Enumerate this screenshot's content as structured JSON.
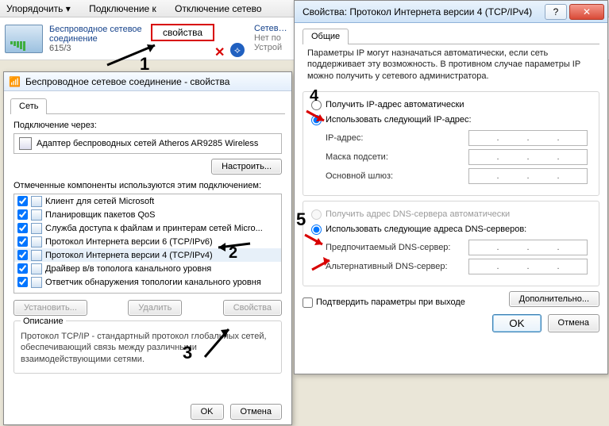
{
  "toolbar": {
    "item1": "Упорядочить ▾",
    "item2": "Подключение к",
    "item3": "Отключение сетево"
  },
  "network": {
    "name": "Беспроводное сетевое",
    "name2": "соединение",
    "detail": "615/3",
    "right_name": "Сетев…",
    "right_status": "Нет по",
    "right_line3": "Устрой"
  },
  "redbox_label": "свойства",
  "annot": {
    "n1": "1",
    "n2": "2",
    "n3": "3",
    "n4": "4",
    "n5": "5"
  },
  "win1": {
    "title": "Беспроводное сетевое соединение - свойства",
    "tab": "Сеть",
    "connect_via": "Подключение через:",
    "adapter": "Адаптер беспроводных сетей Atheros AR9285 Wireless",
    "configure": "Настроить...",
    "components_label": "Отмеченные компоненты используются этим подключением:",
    "items": [
      "Клиент для сетей Microsoft",
      "Планировщик пакетов QoS",
      "Служба доступа к файлам и принтерам сетей Micro...",
      "Протокол Интернета версии 6 (TCP/IPv6)",
      "Протокол Интернета версии 4 (TCP/IPv4)",
      "Драйвер в/в тополога канального уровня",
      "Ответчик обнаружения топологии канального уровня"
    ],
    "install": "Установить...",
    "remove": "Удалить",
    "props": "Свойства",
    "desc_label": "Описание",
    "desc": "Протокол TCP/IP - стандартный протокол глобальных сетей, обеспечивающий связь между различными взаимодействующими сетями.",
    "ok": "OK",
    "cancel": "Отмена"
  },
  "win2": {
    "title": "Свойства: Протокол Интернета версии 4 (TCP/IPv4)",
    "min": "–",
    "tab": "Общие",
    "info": "Параметры IP могут назначаться автоматически, если сеть поддерживает эту возможность. В противном случае параметры IP можно получить у сетевого администратора.",
    "radio_auto_ip": "Получить IP-адрес автоматически",
    "radio_manual_ip": "Использовать следующий IP-адрес:",
    "ip_label": "IP-адрес:",
    "mask_label": "Маска подсети:",
    "gw_label": "Основной шлюз:",
    "radio_auto_dns": "Получить адрес DNS-сервера автоматически",
    "radio_manual_dns": "Использовать следующие адреса DNS-серверов:",
    "dns1_label": "Предпочитаемый DNS-сервер:",
    "dns2_label": "Альтернативный DNS-сервер:",
    "confirm_exit": "Подтвердить параметры при выходе",
    "advanced": "Дополнительно...",
    "ok": "OK",
    "cancel": "Отмена"
  }
}
